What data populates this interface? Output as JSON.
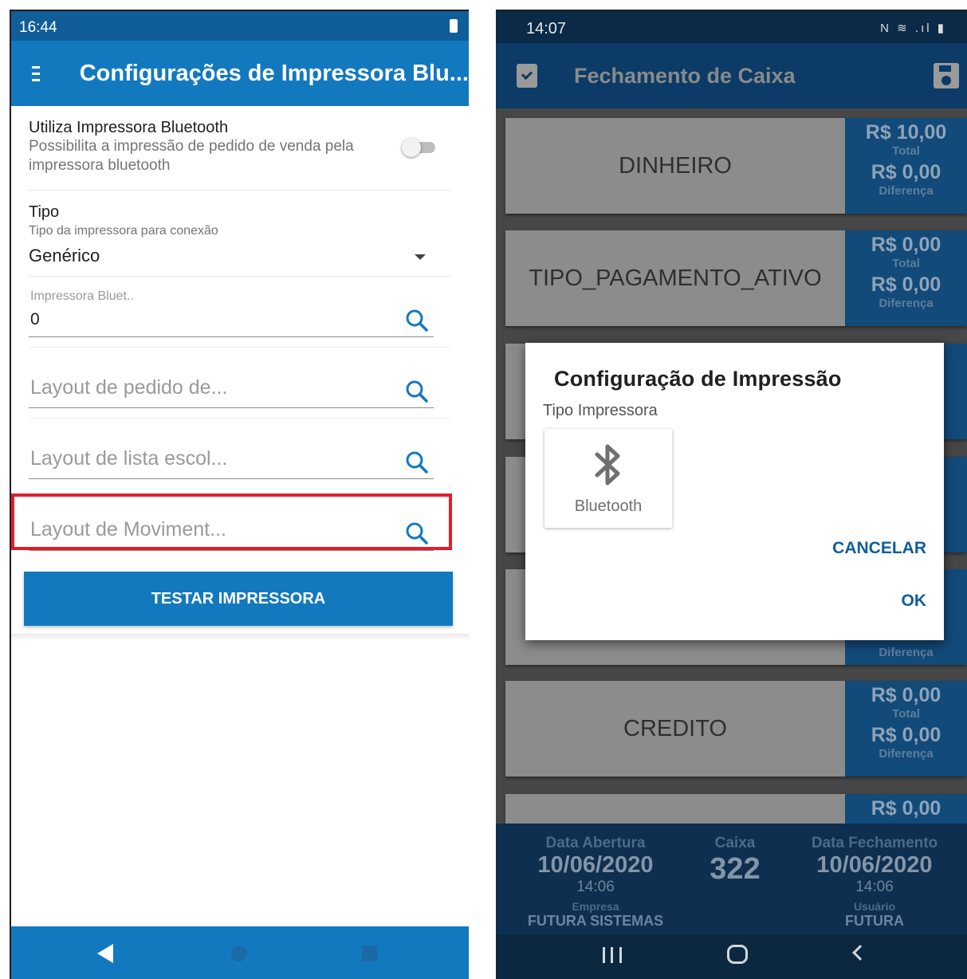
{
  "left_screen": {
    "status_time": "16:44",
    "app_title": "Configurações de Impressora Blu...",
    "bluetooth_pref": {
      "title": "Utiliza Impressora Bluetooth",
      "subtitle": "Possibilita a impressão de pedido de venda pela impressora bluetooth",
      "enabled": false
    },
    "tipo_pref": {
      "title": "Tipo",
      "subtitle": "Tipo da impressora para conexão",
      "value": "Genérico"
    },
    "printer_field": {
      "label": "Impressora Bluet..",
      "value": "0"
    },
    "layout_pedido": {
      "placeholder": "Layout de pedido de..."
    },
    "layout_lista": {
      "placeholder": "Layout de lista escol..."
    },
    "layout_movimento": {
      "placeholder": "Layout de Moviment..."
    },
    "test_button": "TESTAR IMPRESSORA"
  },
  "right_screen": {
    "status_time": "14:07",
    "status_icons": "N ≋ .ıl ▮",
    "app_title": "Fechamento de Caixa",
    "cards": [
      {
        "name": "DINHEIRO",
        "total": "R$ 10,00",
        "total_label": "Total",
        "diff": "R$ 0,00",
        "diff_label": "Diferença"
      },
      {
        "name": "TIPO_PAGAMENTO_ATIVO",
        "total": "R$ 0,00",
        "total_label": "Total",
        "diff": "R$ 0,00",
        "diff_label": "Diferença"
      },
      {
        "name": "CREDITO",
        "total": "R$ 0,00",
        "total_label": "Total",
        "diff": "R$ 0,00",
        "diff_label": "Diferença"
      },
      {
        "total": "R$ 0,00"
      }
    ],
    "hidden_card_label": "Diferença",
    "footer": {
      "abertura_label": "Data Abertura",
      "abertura_date": "10/06/2020",
      "abertura_time": "14:06",
      "caixa_label": "Caixa",
      "caixa_value": "322",
      "fechamento_label": "Data Fechamento",
      "fechamento_date": "10/06/2020",
      "fechamento_time": "14:06",
      "empresa_label": "Empresa",
      "empresa_value": "FUTURA SISTEMAS",
      "usuario_label": "Usuário",
      "usuario_value": "FUTURA"
    },
    "dialog": {
      "title": "Configuração de Impressão",
      "subtitle": "Tipo Impressora",
      "option_label": "Bluetooth",
      "cancel": "CANCELAR",
      "ok": "OK"
    }
  },
  "colors": {
    "accent_blue": "#1279bf",
    "highlight_red": "#e01e2a"
  }
}
